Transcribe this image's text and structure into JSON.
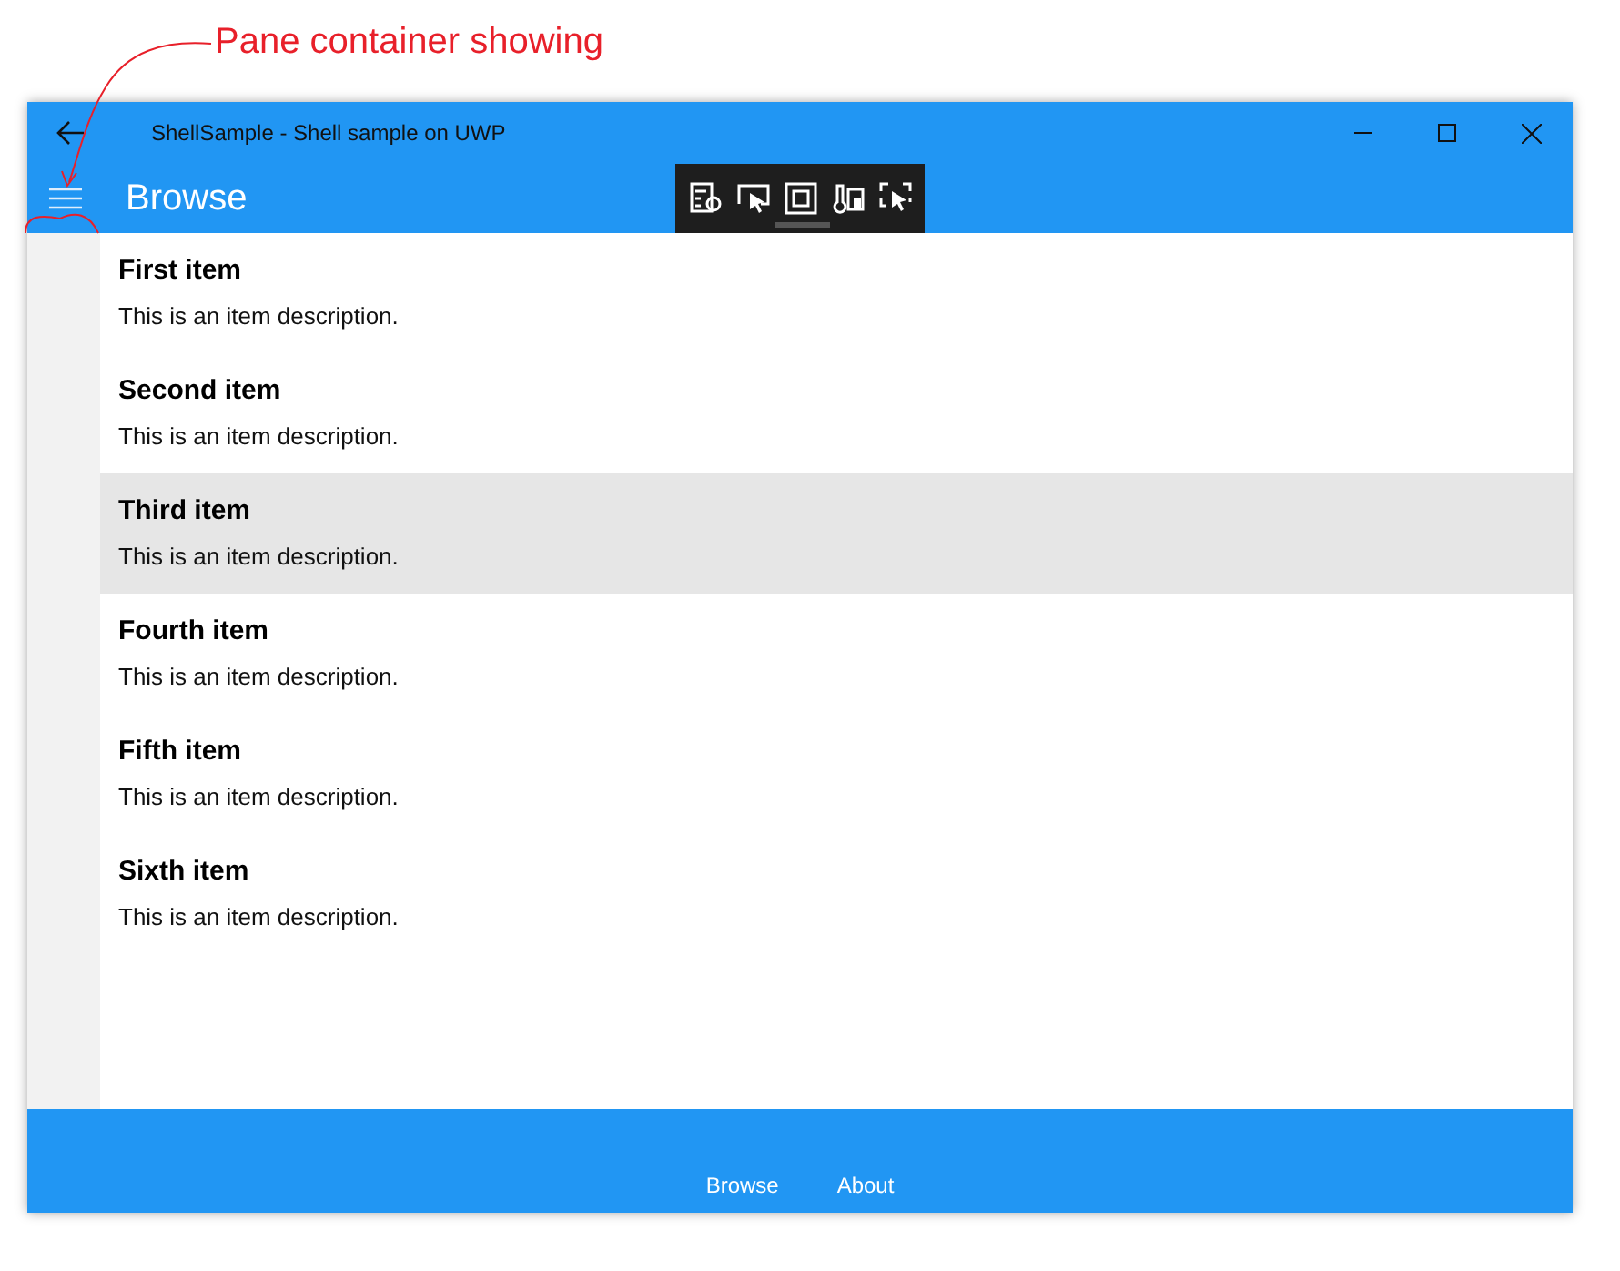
{
  "annotation": {
    "text": "Pane container showing"
  },
  "window": {
    "title": "ShellSample - Shell sample on UWP"
  },
  "navbar": {
    "title": "Browse"
  },
  "items": [
    {
      "title": "First item",
      "description": "This is an item description.",
      "selected": false
    },
    {
      "title": "Second item",
      "description": "This is an item description.",
      "selected": false
    },
    {
      "title": "Third item",
      "description": "This is an item description.",
      "selected": true
    },
    {
      "title": "Fourth item",
      "description": "This is an item description.",
      "selected": false
    },
    {
      "title": "Fifth item",
      "description": "This is an item description.",
      "selected": false
    },
    {
      "title": "Sixth item",
      "description": "This is an item description.",
      "selected": false
    }
  ],
  "tabs": [
    {
      "label": "Browse"
    },
    {
      "label": "About"
    }
  ]
}
